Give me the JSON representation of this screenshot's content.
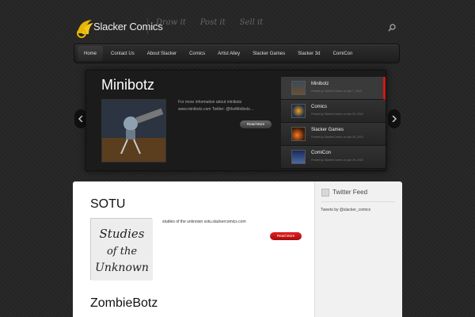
{
  "header": {
    "brand": "Slacker Comics",
    "taglines": [
      "Draw it",
      "Post it",
      "Sell it"
    ],
    "accent": "#e4b407"
  },
  "nav": {
    "items": [
      "Home",
      "Contact Us",
      "About Slacker",
      "Comics",
      "Artist Alley",
      "Slacker Games",
      "Slacker 3d",
      "ComiCon"
    ],
    "active": "Home"
  },
  "featured": {
    "title": "Minibotz",
    "description": "For more information about minibotz www.minibotz.com  Twitter: @theMinibotz...",
    "read_more": "Read More",
    "thumbs": [
      {
        "title": "Minibotz",
        "meta": "Posted by SlackerComics on Apr 7, 2015"
      },
      {
        "title": "Comics",
        "meta": "Posted by SlackerComics on Apr 26, 2015"
      },
      {
        "title": "Slacker Games",
        "meta": "Posted by SlackerComics on Apr 26, 2015"
      },
      {
        "title": "ComiCon",
        "meta": "Posted by SlackerComics on Apr 26, 2015"
      }
    ]
  },
  "posts": [
    {
      "title": "SOTU",
      "excerpt": "studies of the unknown sotu.slackercomics.com",
      "read_more": "Read More",
      "thumb_text": [
        "Studies",
        "of the",
        "Unknown"
      ]
    },
    {
      "title": "ZombieBotz"
    }
  ],
  "sidebar": {
    "widget_title": "Twitter Feed",
    "tweets_by": "Tweets by @slacker_comics"
  },
  "colors": {
    "red": "#d01616",
    "background": "#262626"
  }
}
